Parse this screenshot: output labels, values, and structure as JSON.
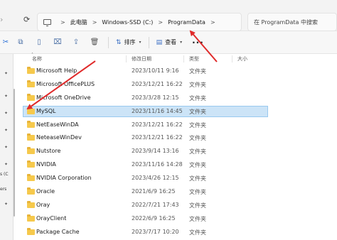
{
  "address": {
    "breadcrumbs": [
      "此电脑",
      "Windows-SSD (C:)",
      "ProgramData"
    ],
    "separator": ">",
    "search_placeholder": "在 ProgramData 中搜索"
  },
  "toolbar": {
    "sort_label": "排序",
    "view_label": "查看",
    "more_label": "···"
  },
  "columns": {
    "name": "名称",
    "date": "修改日期",
    "type": "类型",
    "size": "大小"
  },
  "rows": [
    {
      "name": "Microsoft Help",
      "date": "2023/10/11 9:16",
      "type": "文件夹"
    },
    {
      "name": "Microsoft OfficePLUS",
      "date": "2023/12/21 16:22",
      "type": "文件夹"
    },
    {
      "name": "Microsoft OneDrive",
      "date": "2023/3/28 12:15",
      "type": "文件夹"
    },
    {
      "name": "MySQL",
      "date": "2023/11/16 14:45",
      "type": "文件夹"
    },
    {
      "name": "NetEaseWinDA",
      "date": "2023/12/21 16:22",
      "type": "文件夹"
    },
    {
      "name": "NeteaseWinDev",
      "date": "2023/12/21 16:22",
      "type": "文件夹"
    },
    {
      "name": "Nutstore",
      "date": "2023/9/14 13:16",
      "type": "文件夹"
    },
    {
      "name": "NVIDIA",
      "date": "2023/11/16 14:28",
      "type": "文件夹"
    },
    {
      "name": "NVIDIA Corporation",
      "date": "2023/4/26 12:15",
      "type": "文件夹"
    },
    {
      "name": "Oracle",
      "date": "2021/6/9 16:25",
      "type": "文件夹"
    },
    {
      "name": "Oray",
      "date": "2022/7/21 17:43",
      "type": "文件夹"
    },
    {
      "name": "OrayClient",
      "date": "2022/6/9 16:25",
      "type": "文件夹"
    },
    {
      "name": "Package Cache",
      "date": "2023/7/17 10:20",
      "type": "文件夹"
    }
  ],
  "selected_row": "MySQL",
  "sidebar_fragments": [
    "s (C",
    "ers"
  ],
  "colors": {
    "selection_fill": "#cce4f7",
    "selection_border": "#99c9ef",
    "folder": "#f6c94c",
    "annotation_arrow": "#e02a2a"
  }
}
